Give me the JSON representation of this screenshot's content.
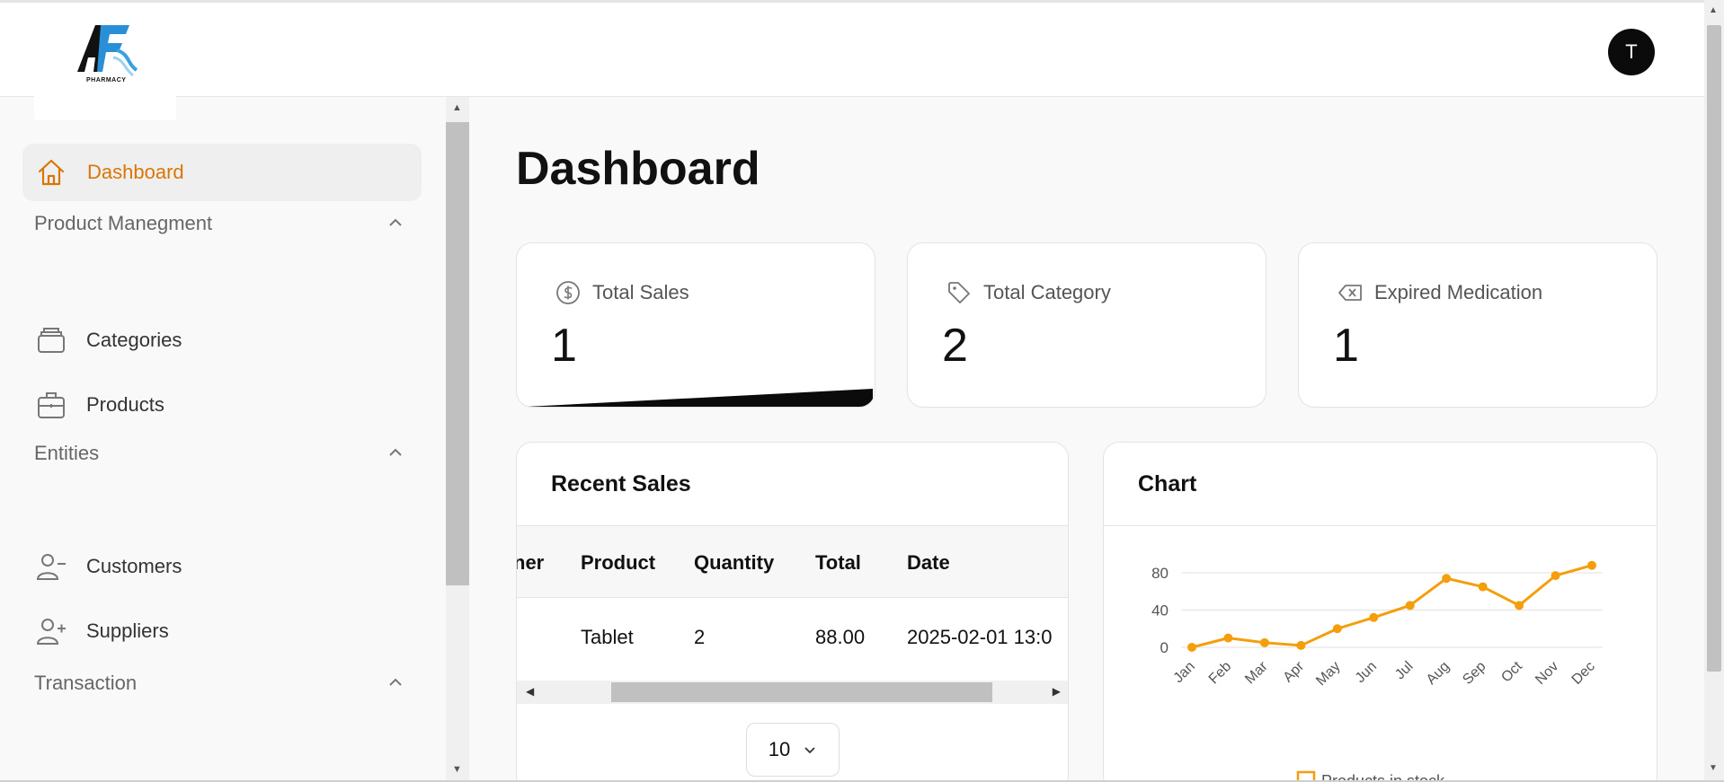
{
  "header": {
    "logo_text": "PHARMACY",
    "avatar_initial": "T"
  },
  "sidebar": {
    "active": {
      "label": "Dashboard",
      "icon": "home-icon"
    },
    "sections": [
      {
        "title": "Product Manegment",
        "items": [
          {
            "label": "Categories",
            "icon": "layers-icon"
          },
          {
            "label": "Products",
            "icon": "briefcase-icon"
          }
        ]
      },
      {
        "title": "Entities",
        "items": [
          {
            "label": "Customers",
            "icon": "user-minus-icon"
          },
          {
            "label": "Suppliers",
            "icon": "user-plus-icon"
          }
        ]
      },
      {
        "title": "Transaction",
        "items": []
      }
    ]
  },
  "main": {
    "title": "Dashboard",
    "stats": [
      {
        "label": "Total Sales",
        "value": "1",
        "icon": "dollar-circle-icon"
      },
      {
        "label": "Total Category",
        "value": "2",
        "icon": "tag-icon"
      },
      {
        "label": "Expired Medication",
        "value": "1",
        "icon": "delete-tag-icon"
      }
    ],
    "recent_sales": {
      "title": "Recent Sales",
      "columns": [
        "ner",
        "Product",
        "Quantity",
        "Total",
        "Date"
      ],
      "rows": [
        {
          "customer": "",
          "product": "Tablet",
          "quantity": "2",
          "total": "88.00",
          "date": "2025-02-01 13:0"
        }
      ],
      "page_size": "10"
    },
    "chart_panel": {
      "title": "Chart"
    }
  },
  "chart_data": {
    "type": "line",
    "categories": [
      "Jan",
      "Feb",
      "Mar",
      "Apr",
      "May",
      "Jun",
      "Jul",
      "Aug",
      "Sep",
      "Oct",
      "Nov",
      "Dec"
    ],
    "series": [
      {
        "name": "Products in stock",
        "values": [
          0,
          10,
          5,
          2,
          20,
          32,
          45,
          74,
          65,
          45,
          77,
          88
        ],
        "color": "#f59e0b"
      }
    ],
    "yticks": [
      "0",
      "40",
      "80"
    ],
    "ylim": [
      0,
      90
    ],
    "grid": true,
    "legend": "bottom"
  },
  "colors": {
    "accent": "#d97706",
    "series": "#f59e0b"
  }
}
